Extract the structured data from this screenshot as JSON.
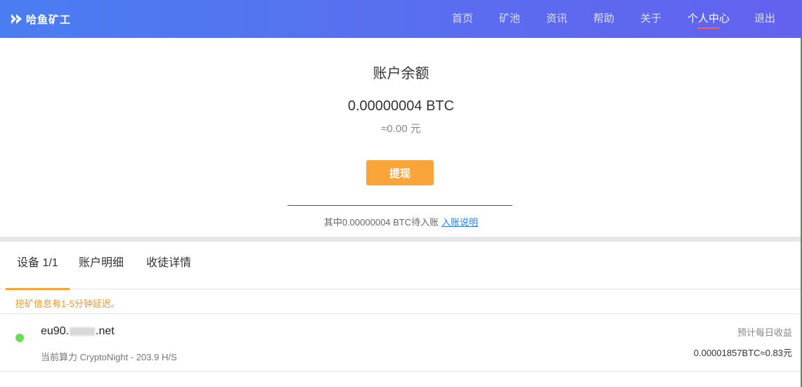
{
  "header": {
    "logo_text": "哈鱼矿工",
    "nav": [
      {
        "label": "首页",
        "active": false
      },
      {
        "label": "矿池",
        "active": false
      },
      {
        "label": "资讯",
        "active": false
      },
      {
        "label": "帮助",
        "active": false
      },
      {
        "label": "关于",
        "active": false
      },
      {
        "label": "个人中心",
        "active": true
      },
      {
        "label": "退出",
        "active": false
      }
    ]
  },
  "balance": {
    "title": "账户余额",
    "amount": "0.00000004 BTC",
    "cny": "≈0.00 元",
    "withdraw_label": "提现",
    "pending_text": "其中0.00000004 BTC待入账",
    "pending_link": "入账说明"
  },
  "tabs": [
    {
      "label": "设备 1/1",
      "active": true
    },
    {
      "label": "账户明细",
      "active": false
    },
    {
      "label": "收徒详情",
      "active": false
    }
  ],
  "notice": "挖矿信息有1-5分钟延迟。",
  "devices": [
    {
      "name_prefix": "eu90.",
      "name_suffix": ".net",
      "status": "online",
      "hashrate": "当前算力 CryptoNight - 203.9 H/S",
      "earn_label": "预计每日收益",
      "earn_value": "0.00001857BTC≈0.83元"
    }
  ],
  "colors": {
    "header_start": "#4a7df2",
    "header_end": "#6262ee",
    "accent_orange": "#f9a53a",
    "link_blue": "#2a7ee6",
    "online_green": "#66dd55",
    "nav_active_underline": "#ff5a5a"
  }
}
